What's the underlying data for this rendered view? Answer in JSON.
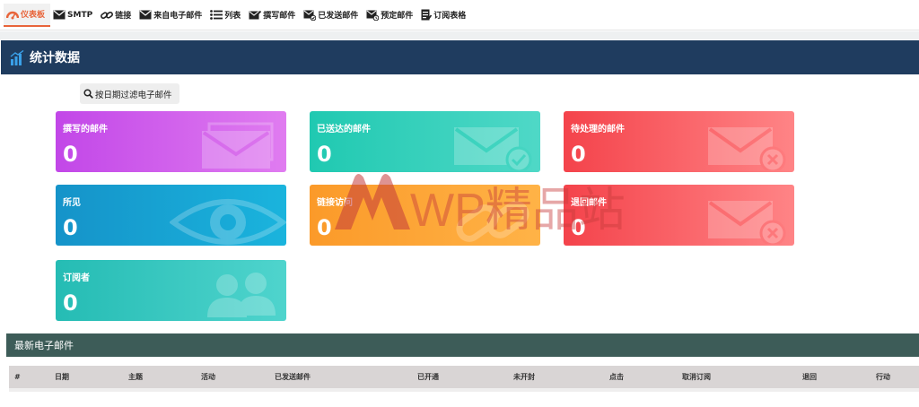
{
  "nav": {
    "items": [
      {
        "label": "仪表板",
        "icon": "dashboard-icon"
      },
      {
        "label": "SMTP",
        "icon": "envelope-icon"
      },
      {
        "label": "链接",
        "icon": "link-icon"
      },
      {
        "label": "来自电子邮件",
        "icon": "envelope-icon"
      },
      {
        "label": "列表",
        "icon": "list-icon"
      },
      {
        "label": "撰写邮件",
        "icon": "compose-mail-icon"
      },
      {
        "label": "已发送邮件",
        "icon": "sent-mail-icon"
      },
      {
        "label": "预定邮件",
        "icon": "scheduled-mail-icon"
      },
      {
        "label": "订阅表格",
        "icon": "form-icon"
      }
    ],
    "active_color": "#e8643a"
  },
  "panel": {
    "title": "统计数据",
    "icon": "bar-chart-icon",
    "color": "#1f3c5f"
  },
  "filter": {
    "label": "按日期过滤电子邮件",
    "icon": "search-icon"
  },
  "cards": [
    {
      "title": "撰写的邮件",
      "value": "0",
      "icon": "envelope-icon"
    },
    {
      "title": "已送达的邮件",
      "value": "0",
      "icon": "envelope-check-icon"
    },
    {
      "title": "待处理的邮件",
      "value": "0",
      "icon": "envelope-x-icon"
    },
    {
      "title": "所见",
      "value": "0",
      "icon": "eye-icon"
    },
    {
      "title": "链接访问",
      "value": "0",
      "icon": "link-icon"
    },
    {
      "title": "退回邮件",
      "value": "0",
      "icon": "envelope-x-icon"
    },
    {
      "title": "订阅者",
      "value": "0",
      "icon": "users-icon"
    }
  ],
  "watermark": {
    "text": "WP精品站"
  },
  "recent": {
    "title": "最新电子邮件",
    "columns": [
      "#",
      "日期",
      "主题",
      "活动",
      "已发送邮件",
      "已开通",
      "未开封",
      "点击",
      "取消订阅",
      "退回",
      "行动"
    ]
  }
}
